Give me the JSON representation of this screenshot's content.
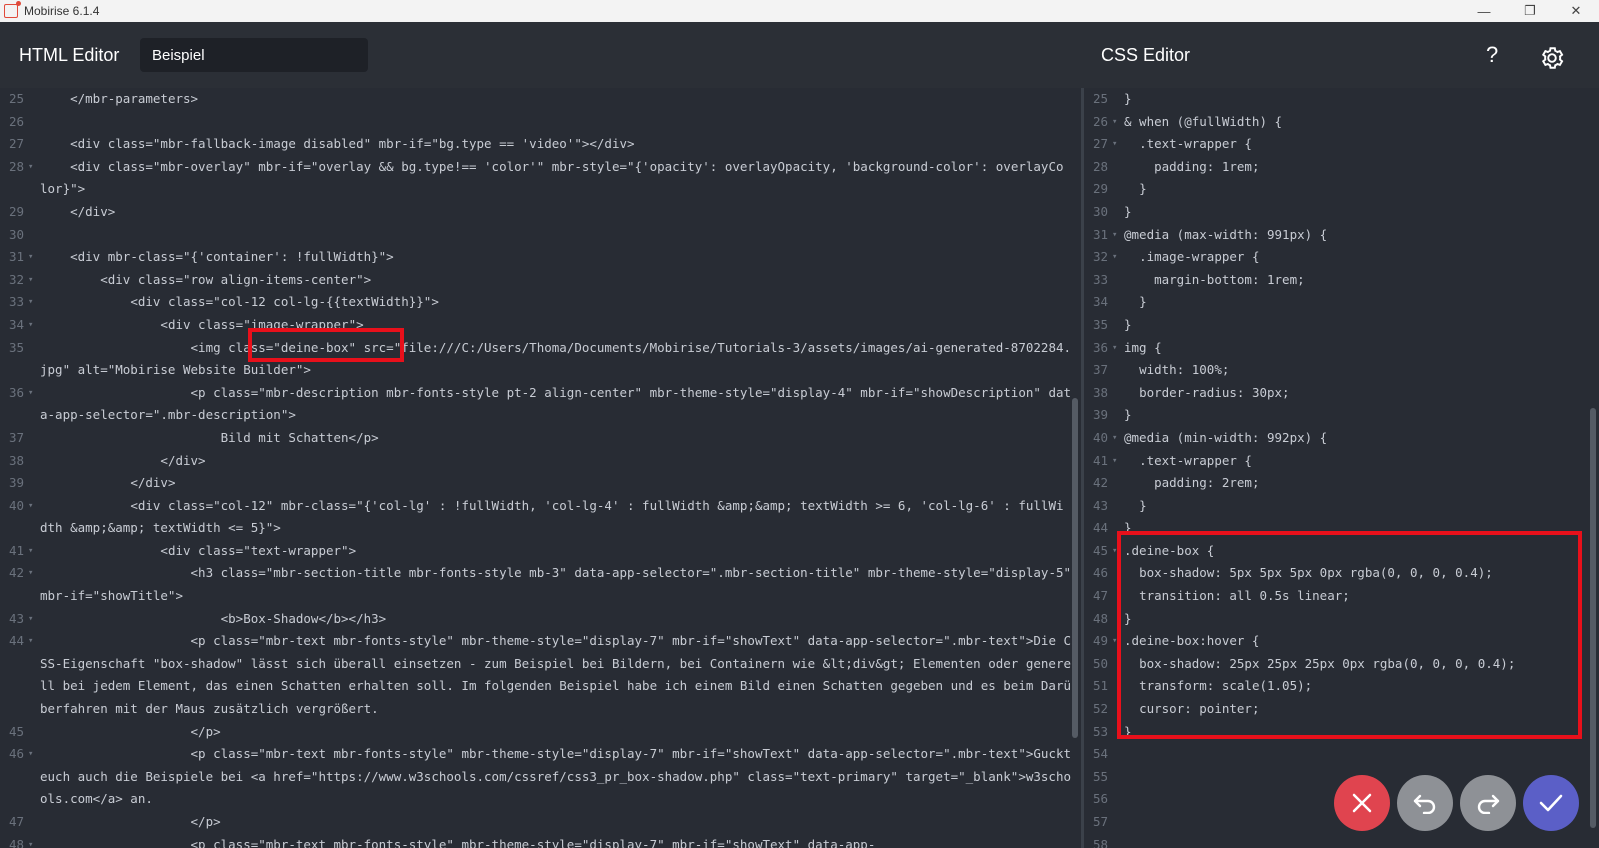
{
  "window": {
    "title": "Mobirise 6.1.4",
    "controls": [
      "—",
      "❐",
      "✕"
    ]
  },
  "header": {
    "html_editor_label": "HTML Editor",
    "page_name_value": "Beispiel",
    "css_editor_label": "CSS Editor",
    "help_label": "?"
  },
  "html_editor": {
    "lines": [
      {
        "n": "25",
        "fold": "",
        "text": "    </mbr-parameters>"
      },
      {
        "n": "26",
        "fold": "",
        "text": ""
      },
      {
        "n": "27",
        "fold": "",
        "text": "    <div class=\"mbr-fallback-image disabled\" mbr-if=\"bg.type == 'video'\"></div>"
      },
      {
        "n": "28",
        "fold": "▾",
        "text": "    <div class=\"mbr-overlay\" mbr-if=\"overlay && bg.type!== 'color'\" mbr-style=\"{'opacity': overlayOpacity, 'background-color': overlayColor}\">"
      },
      {
        "n": "29",
        "fold": "",
        "text": "    </div>"
      },
      {
        "n": "30",
        "fold": "",
        "text": ""
      },
      {
        "n": "31",
        "fold": "▾",
        "text": "    <div mbr-class=\"{'container': !fullWidth}\">"
      },
      {
        "n": "32",
        "fold": "▾",
        "text": "        <div class=\"row align-items-center\">"
      },
      {
        "n": "33",
        "fold": "▾",
        "text": "            <div class=\"col-12 col-lg-{{textWidth}}\">"
      },
      {
        "n": "34",
        "fold": "▾",
        "text": "                <div class=\"image-wrapper\">"
      },
      {
        "n": "35",
        "fold": "",
        "text": "                    <img class=\"deine-box\" src=\"file:///C:/Users/Thoma/Documents/Mobirise/Tutorials-3/assets/images/ai-generated-8702284.jpg\" alt=\"Mobirise Website Builder\">"
      },
      {
        "n": "36",
        "fold": "▾",
        "text": "                    <p class=\"mbr-description mbr-fonts-style pt-2 align-center\" mbr-theme-style=\"display-4\" mbr-if=\"showDescription\" data-app-selector=\".mbr-description\">"
      },
      {
        "n": "37",
        "fold": "",
        "text": "                        Bild mit Schatten</p>"
      },
      {
        "n": "38",
        "fold": "",
        "text": "                </div>"
      },
      {
        "n": "39",
        "fold": "",
        "text": "            </div>"
      },
      {
        "n": "40",
        "fold": "▾",
        "text": "            <div class=\"col-12\" mbr-class=\"{'col-lg' : !fullWidth, 'col-lg-4' : fullWidth &amp;&amp; textWidth >= 6, 'col-lg-6' : fullWidth &amp;&amp; textWidth <= 5}\">"
      },
      {
        "n": "41",
        "fold": "▾",
        "text": "                <div class=\"text-wrapper\">"
      },
      {
        "n": "42",
        "fold": "▾",
        "text": "                    <h3 class=\"mbr-section-title mbr-fonts-style mb-3\" data-app-selector=\".mbr-section-title\" mbr-theme-style=\"display-5\" mbr-if=\"showTitle\">"
      },
      {
        "n": "43",
        "fold": "▾",
        "text": "                        <b>Box-Shadow</b></h3>"
      },
      {
        "n": "44",
        "fold": "▾",
        "text": "                    <p class=\"mbr-text mbr-fonts-style\" mbr-theme-style=\"display-7\" mbr-if=\"showText\" data-app-selector=\".mbr-text\">Die CSS-Eigenschaft \"box-shadow\" lässt sich überall einsetzen - zum Beispiel bei Bildern, bei Containern wie &lt;div&gt; Elementen oder generell bei jedem Element, das einen Schatten erhalten soll. Im folgenden Beispiel habe ich einem Bild einen Schatten gegeben und es beim Darüberfahren mit der Maus zusätzlich vergrößert."
      },
      {
        "n": "45",
        "fold": "",
        "text": "                    </p>"
      },
      {
        "n": "46",
        "fold": "▾",
        "text": "                    <p class=\"mbr-text mbr-fonts-style\" mbr-theme-style=\"display-7\" mbr-if=\"showText\" data-app-selector=\".mbr-text\">Guckt euch auch die Beispiele bei <a href=\"https://www.w3schools.com/cssref/css3_pr_box-shadow.php\" class=\"text-primary\" target=\"_blank\">w3schools.com</a> an."
      },
      {
        "n": "47",
        "fold": "",
        "text": "                    </p>"
      },
      {
        "n": "48",
        "fold": "▾",
        "text": "                    <p class=\"mbr-text mbr-fonts-style\" mbr-theme-style=\"display-7\" mbr-if=\"showText\" data-app-"
      }
    ]
  },
  "css_editor": {
    "lines": [
      {
        "n": "25",
        "fold": "",
        "text": "}"
      },
      {
        "n": "26",
        "fold": "▾",
        "text": "& when (@fullWidth) {"
      },
      {
        "n": "27",
        "fold": "▾",
        "text": "  .text-wrapper {"
      },
      {
        "n": "28",
        "fold": "",
        "text": "    padding: 1rem;"
      },
      {
        "n": "29",
        "fold": "",
        "text": "  }"
      },
      {
        "n": "30",
        "fold": "",
        "text": "}"
      },
      {
        "n": "31",
        "fold": "▾",
        "text": "@media (max-width: 991px) {"
      },
      {
        "n": "32",
        "fold": "▾",
        "text": "  .image-wrapper {"
      },
      {
        "n": "33",
        "fold": "",
        "text": "    margin-bottom: 1rem;"
      },
      {
        "n": "34",
        "fold": "",
        "text": "  }"
      },
      {
        "n": "35",
        "fold": "",
        "text": "}"
      },
      {
        "n": "36",
        "fold": "▾",
        "text": "img {"
      },
      {
        "n": "37",
        "fold": "",
        "text": "  width: 100%;"
      },
      {
        "n": "38",
        "fold": "",
        "text": "  border-radius: 30px;"
      },
      {
        "n": "39",
        "fold": "",
        "text": "}"
      },
      {
        "n": "40",
        "fold": "▾",
        "text": "@media (min-width: 992px) {"
      },
      {
        "n": "41",
        "fold": "▾",
        "text": "  .text-wrapper {"
      },
      {
        "n": "42",
        "fold": "",
        "text": "    padding: 2rem;"
      },
      {
        "n": "43",
        "fold": "",
        "text": "  }"
      },
      {
        "n": "44",
        "fold": "",
        "text": "}"
      },
      {
        "n": "45",
        "fold": "▾",
        "text": ".deine-box {"
      },
      {
        "n": "46",
        "fold": "",
        "text": "  box-shadow: 5px 5px 5px 0px rgba(0, 0, 0, 0.4);"
      },
      {
        "n": "47",
        "fold": "",
        "text": "  transition: all 0.5s linear;"
      },
      {
        "n": "48",
        "fold": "",
        "text": "}"
      },
      {
        "n": "49",
        "fold": "▾",
        "text": ".deine-box:hover {"
      },
      {
        "n": "50",
        "fold": "",
        "text": "  box-shadow: 25px 25px 25px 0px rgba(0, 0, 0, 0.4);"
      },
      {
        "n": "51",
        "fold": "",
        "text": "  transform: scale(1.05);"
      },
      {
        "n": "52",
        "fold": "",
        "text": "  cursor: pointer;"
      },
      {
        "n": "53",
        "fold": "",
        "text": "}"
      },
      {
        "n": "54",
        "fold": "",
        "text": ""
      },
      {
        "n": "55",
        "fold": "",
        "text": ""
      },
      {
        "n": "56",
        "fold": "",
        "text": ""
      },
      {
        "n": "57",
        "fold": "",
        "text": ""
      },
      {
        "n": "58",
        "fold": "",
        "text": ""
      }
    ]
  },
  "actions": {
    "icons": [
      "close-icon",
      "undo-icon",
      "redo-icon",
      "check-icon"
    ]
  },
  "colors": {
    "background": "#2b2f36",
    "editor_bg": "#282c34",
    "highlight": "#e8101b",
    "close": "#e0444f",
    "history": "#8e9196",
    "confirm": "#5b5fc7"
  }
}
